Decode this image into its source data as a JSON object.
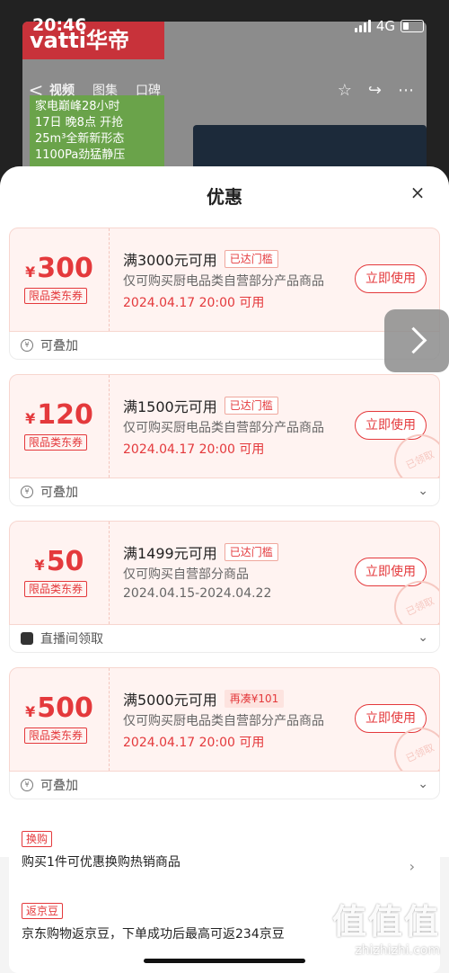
{
  "status_bar": {
    "time": "20:46",
    "network": "4G"
  },
  "background": {
    "brand": "vatti华帝",
    "promo_lines": [
      "家电巅峰28小时",
      "17日 晚8点 开抢",
      "25m³全新新形态",
      "1100Pa劲猛静压"
    ],
    "nav": {
      "back": "<",
      "tabs": [
        "视频",
        "图集",
        "口碑"
      ],
      "icons": [
        "star-icon",
        "share-icon",
        "more-icon"
      ]
    }
  },
  "sheet": {
    "title": "优惠",
    "close_label": "×"
  },
  "coupons": [
    {
      "yen": "¥",
      "amount": "300",
      "tag": "限品类东券",
      "condition": "满3000元可用",
      "badge": "已达门槛",
      "badge_style": "outline",
      "scope": "仅可购买厨电品类自营部分产品商品",
      "date": "2024.04.17 20:00 可用",
      "date_style": "red",
      "button": "立即使用",
      "footer": "可叠加",
      "footer_icon": "coin-icon",
      "stamp": false,
      "chevron": false
    },
    {
      "yen": "¥",
      "amount": "120",
      "tag": "限品类东券",
      "condition": "满1500元可用",
      "badge": "已达门槛",
      "badge_style": "outline",
      "scope": "仅可购买厨电品类自营部分产品商品",
      "date": "2024.04.17 20:00 可用",
      "date_style": "red",
      "button": "立即使用",
      "footer": "可叠加",
      "footer_icon": "coin-icon",
      "stamp": true,
      "chevron": true
    },
    {
      "yen": "¥",
      "amount": "50",
      "tag": "限品类东券",
      "condition": "满1499元可用",
      "badge": "已达门槛",
      "badge_style": "outline",
      "scope": "仅可购买自营部分商品",
      "date": "2024.04.15-2024.04.22",
      "date_style": "gray",
      "button": "立即使用",
      "footer": "直播间领取",
      "footer_icon": "live-icon",
      "stamp": true,
      "chevron": true
    },
    {
      "yen": "¥",
      "amount": "500",
      "tag": "限品类东券",
      "condition": "满5000元可用",
      "badge": "再凑¥101",
      "badge_style": "solid",
      "scope": "仅可购买厨电品类自营部分产品商品",
      "date": "2024.04.17 20:00 可用",
      "date_style": "red",
      "button": "立即使用",
      "footer": "可叠加",
      "footer_icon": "coin-icon",
      "stamp": true,
      "chevron": true
    }
  ],
  "stamp_text": "已领取",
  "extras": [
    {
      "tag": "换购",
      "text": "购买1件可优惠换购热销商品"
    },
    {
      "tag": "返京豆",
      "text": "京东购物返京豆，下单成功后最高可返234京豆"
    }
  ],
  "watermark": {
    "logo": "值值值",
    "url": "zhizhizhi.com"
  },
  "colors": {
    "accent": "#e4393c",
    "coupon_bg": "#fff3f1"
  }
}
